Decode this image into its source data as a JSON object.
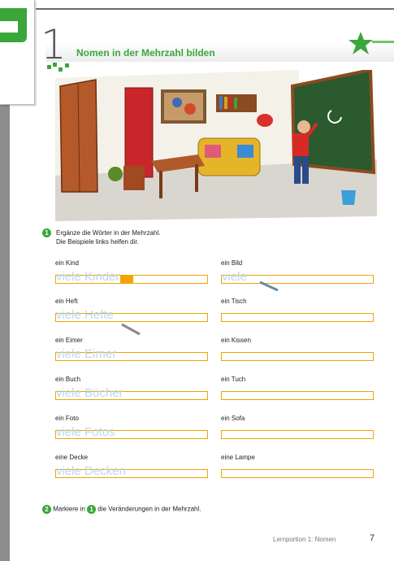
{
  "header": {
    "number": "1",
    "title": "Nomen in der Mehrzahl bilden"
  },
  "task1": {
    "number": "1",
    "line1": "Ergänze die Wörter in der Mehrzahl.",
    "line2": "Die Beispiele links helfen dir."
  },
  "words": [
    {
      "word": "ein Kind",
      "answer": "viele Kinder"
    },
    {
      "word": "ein Bild",
      "answer": "viele"
    },
    {
      "word": "ein Heft",
      "answer": "viele Hefte"
    },
    {
      "word": "ein Tisch",
      "answer": ""
    },
    {
      "word": "ein Eimer",
      "answer": "viele Eimer"
    },
    {
      "word": "ein Kissen",
      "answer": ""
    },
    {
      "word": "ein Buch",
      "answer": "viele Bücher"
    },
    {
      "word": "ein Tuch",
      "answer": ""
    },
    {
      "word": "ein Foto",
      "answer": "viele Fotos"
    },
    {
      "word": "ein Sofa",
      "answer": ""
    },
    {
      "word": "eine Decke",
      "answer": "viele Decken"
    },
    {
      "word": "eine Lampe",
      "answer": ""
    }
  ],
  "task2": {
    "number": "2",
    "before": "Markiere in",
    "ref": "1",
    "after": "die Veränderungen in der Mehrzahl."
  },
  "footer": {
    "text": "Lernportion 1:  Nomen",
    "page": "7"
  },
  "colors": {
    "accent": "#3aa63a",
    "line": "#f0a500",
    "answer": "#b8d8ef"
  }
}
